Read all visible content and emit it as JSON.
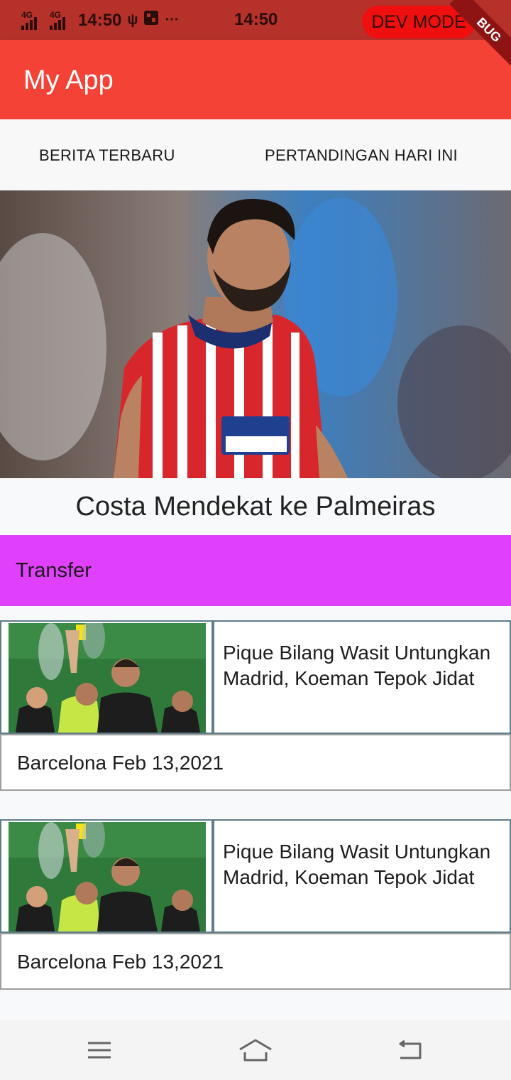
{
  "status_bar": {
    "network_1": "4G",
    "network_2": "4G",
    "time_left": "14:50",
    "usb_glyph": "ψ",
    "more_glyph": "···",
    "time_center": "14:50",
    "dev_mode": "DEV MODE"
  },
  "debug_banner": "BUG",
  "app_bar": {
    "title": "My App"
  },
  "tabs": [
    {
      "label": "BERITA TERBARU"
    },
    {
      "label": "PERTANDINGAN HARI INI"
    }
  ],
  "hero": {
    "title": "Costa Mendekat ke Palmeiras"
  },
  "category": {
    "label": "Transfer"
  },
  "news": [
    {
      "title": "Pique Bilang Wasit Untungkan Madrid, Koeman Tepok Jidat",
      "meta": "Barcelona Feb 13,2021"
    },
    {
      "title": "Pique Bilang Wasit Untungkan Madrid, Koeman Tepok Jidat",
      "meta": "Barcelona Feb 13,2021"
    }
  ],
  "nav": {
    "icons": [
      "menu-icon",
      "home-icon",
      "back-icon"
    ]
  },
  "colors": {
    "status_bar": "#b5312a",
    "app_bar": "#f44336",
    "dev_mode_pill": "#ef0f0f",
    "category_band": "#e040fb",
    "card_border": "#607d8b"
  }
}
